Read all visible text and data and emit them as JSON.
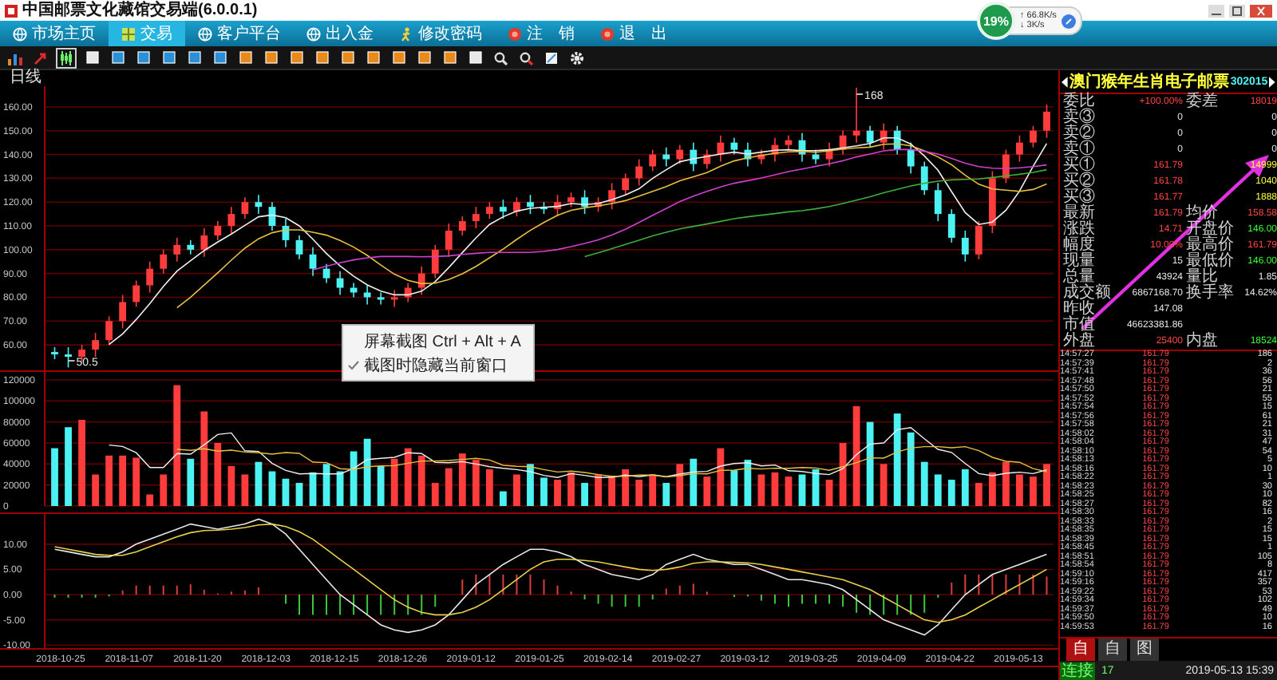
{
  "window": {
    "title": "中国邮票文化藏馆交易端(6.0.0.1)"
  },
  "network": {
    "percent": "19%",
    "upload": "↑ 66.8K/s",
    "download": "↓ 3K/s"
  },
  "tabs": [
    {
      "label": "市场主页",
      "selected": false
    },
    {
      "label": "交易",
      "selected": true
    },
    {
      "label": "客户平台",
      "selected": false
    },
    {
      "label": "出入金",
      "selected": false
    },
    {
      "label": "修改密码",
      "selected": false
    },
    {
      "label": "注　销",
      "selected": false
    },
    {
      "label": "退　出",
      "selected": false
    }
  ],
  "toolbar": [
    {
      "selected": false
    },
    {
      "selected": false
    },
    {
      "selected": true
    },
    {
      "selected": false
    },
    {
      "selected": false
    },
    {
      "selected": false
    },
    {
      "selected": false
    },
    {
      "selected": false
    },
    {
      "selected": false
    },
    {
      "selected": false
    },
    {
      "selected": false
    },
    {
      "selected": false
    },
    {
      "selected": false
    },
    {
      "selected": false
    },
    {
      "selected": false
    },
    {
      "selected": false
    },
    {
      "selected": false
    },
    {
      "selected": false
    },
    {
      "selected": false
    },
    {
      "selected": false
    },
    {
      "selected": false
    },
    {
      "selected": false
    },
    {
      "selected": false
    }
  ],
  "period": "日线",
  "price_chart": {
    "chart_data": {
      "type": "candlestick",
      "ylim": [
        49.3,
        168.7
      ],
      "grid": true,
      "series": [
        {
          "colors": [
            "#4cf2f2",
            "#4cf2f2",
            "#ff3c3c",
            "#ff3c3c",
            "#ff3c3c",
            "#ff3c3c",
            "#ff3c3c",
            "#ff3c3c",
            "#ff3c3c",
            "#ff3c3c",
            "#4cf2f2",
            "#ff3c3c",
            "#ff3c3c",
            "#ff3c3c",
            "#ff3c3c",
            "#4cf2f2",
            "#4cf2f2",
            "#4cf2f2",
            "#4cf2f2",
            "#4cf2f2",
            "#4cf2f2",
            "#4cf2f2",
            "#4cf2f2",
            "#4cf2f2",
            "#4cf2f2",
            "#ff3c3c",
            "#ff3c3c",
            "#ff3c3c",
            "#ff3c3c",
            "#ff3c3c",
            "#ff3c3c",
            "#ff3c3c",
            "#ff3c3c",
            "#4cf2f2",
            "#ff3c3c",
            "#4cf2f2",
            "#4cf2f2",
            "#ff3c3c",
            "#ff3c3c",
            "#4cf2f2",
            "#ff3c3c",
            "#ff3c3c",
            "#ff3c3c",
            "#ff3c3c",
            "#ff3c3c",
            "#4cf2f2",
            "#ff3c3c",
            "#4cf2f2",
            "#ff3c3c",
            "#ff3c3c",
            "#4cf2f2",
            "#4cf2f2",
            "#ff3c3c",
            "#ff3c3c",
            "#ff3c3c",
            "#4cf2f2",
            "#4cf2f2",
            "#ff3c3c",
            "#ff3c3c",
            "#ff3c3c",
            "#4cf2f2",
            "#ff3c3c",
            "#4cf2f2",
            "#4cf2f2",
            "#4cf2f2",
            "#4cf2f2",
            "#4cf2f2",
            "#4cf2f2",
            "#ff3c3c",
            "#ff3c3c",
            "#ff3c3c",
            "#ff3c3c",
            "#ff3c3c",
            "#ff3c3c"
          ],
          "ohlc": [
            [
              57,
              59,
              54,
              56
            ],
            [
              56,
              59,
              50.5,
              55
            ],
            [
              55,
              60,
              53,
              58
            ],
            [
              58,
              65,
              55,
              62
            ],
            [
              62,
              72,
              60,
              70
            ],
            [
              70,
              81,
              67,
              78
            ],
            [
              78,
              87,
              76,
              85
            ],
            [
              85,
              95,
              82,
              92
            ],
            [
              92,
              100,
              90,
              98
            ],
            [
              98,
              105,
              95,
              102
            ],
            [
              102,
              104,
              98,
              100
            ],
            [
              100,
              109,
              97,
              106
            ],
            [
              106,
              112,
              104,
              110
            ],
            [
              110,
              118,
              107,
              115
            ],
            [
              115,
              122,
              113,
              120
            ],
            [
              120,
              123,
              115,
              118
            ],
            [
              118,
              120,
              108,
              110
            ],
            [
              110,
              113,
              101,
              104
            ],
            [
              104,
              106,
              96,
              98
            ],
            [
              98,
              101,
              89,
              92
            ],
            [
              92,
              94,
              86,
              88
            ],
            [
              88,
              91,
              81,
              84
            ],
            [
              84,
              86,
              80,
              82
            ],
            [
              82,
              85,
              77,
              80
            ],
            [
              80,
              82,
              77,
              79
            ],
            [
              79,
              83,
              76,
              80
            ],
            [
              80,
              86,
              78,
              84
            ],
            [
              84,
              93,
              81,
              90
            ],
            [
              90,
              102,
              88,
              100
            ],
            [
              100,
              111,
              97,
              108
            ],
            [
              108,
              114,
              106,
              112
            ],
            [
              112,
              118,
              109,
              115
            ],
            [
              115,
              120,
              113,
              118
            ],
            [
              118,
              121,
              113,
              116
            ],
            [
              116,
              122,
              114,
              120
            ],
            [
              120,
              123,
              115,
              118
            ],
            [
              118,
              120,
              115,
              117
            ],
            [
              117,
              123,
              114,
              120
            ],
            [
              120,
              124,
              118,
              122
            ],
            [
              122,
              125,
              115,
              118
            ],
            [
              118,
              122,
              116,
              120
            ],
            [
              120,
              128,
              117,
              125
            ],
            [
              125,
              132,
              123,
              130
            ],
            [
              130,
              138,
              127,
              135
            ],
            [
              135,
              142,
              133,
              140
            ],
            [
              140,
              143,
              135,
              138
            ],
            [
              138,
              144,
              136,
              142
            ],
            [
              142,
              145,
              133,
              136
            ],
            [
              136,
              142,
              134,
              140
            ],
            [
              140,
              148,
              137,
              145
            ],
            [
              145,
              147,
              140,
              142
            ],
            [
              142,
              145,
              135,
              138
            ],
            [
              138,
              142,
              136,
              140
            ],
            [
              140,
              147,
              137,
              144
            ],
            [
              144,
              148,
              142,
              146
            ],
            [
              146,
              149,
              137,
              140
            ],
            [
              140,
              142,
              136,
              138
            ],
            [
              138,
              145,
              135,
              142
            ],
            [
              142,
              150,
              140,
              148
            ],
            [
              148,
              168,
              145,
              150
            ],
            [
              150,
              152,
              143,
              145
            ],
            [
              145,
              153,
              142,
              150
            ],
            [
              150,
              152,
              140,
              142
            ],
            [
              142,
              145,
              132,
              135
            ],
            [
              135,
              137,
              123,
              125
            ],
            [
              125,
              128,
              112,
              115
            ],
            [
              115,
              117,
              103,
              105
            ],
            [
              105,
              108,
              95,
              98
            ],
            [
              98,
              112,
              96,
              110
            ],
            [
              110,
              133,
              107,
              130
            ],
            [
              130,
              142,
              128,
              140
            ],
            [
              140,
              148,
              137,
              145
            ],
            [
              145,
              152,
              143,
              150
            ],
            [
              150,
              161,
              147,
              158
            ]
          ]
        },
        {
          "type": "line",
          "color": "#f0f0f0",
          "values": [
            null,
            null,
            null,
            null,
            60.2,
            64.6,
            70.6,
            77.4,
            84.6,
            91,
            95.4,
            99.6,
            103.2,
            106.6,
            110.2,
            113.8,
            114.6,
            113.4,
            110,
            104.4,
            98.4,
            93.2,
            88.8,
            85.2,
            82.6,
            81,
            81,
            82.6,
            86.6,
            92.4,
            98.8,
            105,
            110.6,
            113.8,
            116.2,
            117.4,
            117.8,
            118.2,
            119.4,
            119,
            119.4,
            121,
            123,
            125.6,
            130,
            133.6,
            137,
            138.2,
            139.2,
            140.2,
            141,
            140.2,
            141,
            141.8,
            142,
            141.6,
            141.6,
            142,
            142.8,
            143.6,
            144.6,
            147,
            147,
            144.4,
            139.4,
            133.4,
            124.4,
            115.6,
            110.6,
            111.6,
            116.6,
            124.6,
            135,
            144.6
          ]
        },
        {
          "type": "line",
          "color": "#e8c040",
          "values": [
            null,
            null,
            null,
            null,
            null,
            null,
            null,
            null,
            null,
            75.6,
            80,
            85.1,
            90.3,
            95.6,
            100.6,
            104.6,
            107.1,
            108.3,
            108.3,
            107.3,
            106.1,
            103.9,
            101.1,
            97.6,
            93.5,
            89.7,
            87.1,
            85.7,
            85.9,
            87.5,
            89.9,
            93,
            96.6,
            100.2,
            104.3,
            108.1,
            111.4,
            114.4,
            116.6,
            117.6,
            118.4,
            119.4,
            120.6,
            122.5,
            124.5,
            126.5,
            129,
            130.6,
            132.4,
            135.1,
            137.3,
            138.6,
            139.6,
            140.5,
            141.1,
            141.3,
            140.9,
            141.5,
            142.3,
            142.8,
            143.1,
            144.3,
            144.5,
            143.6,
            141.5,
            139,
            135.7,
            131.3,
            127.5,
            125.5,
            125,
            124.5,
            125.3,
            127.6
          ]
        },
        {
          "type": "line",
          "color": "#d040d0",
          "values": [
            null,
            null,
            null,
            null,
            null,
            null,
            null,
            null,
            null,
            null,
            null,
            null,
            null,
            null,
            null,
            null,
            null,
            null,
            null,
            91.5,
            93.1,
            94.5,
            95.7,
            96.6,
            97.1,
            97.2,
            97.1,
            97,
            97.1,
            97.4,
            98,
            98.5,
            98.9,
            98.9,
            98.9,
            98.9,
            99.3,
            100.1,
            101.3,
            102.6,
            104.2,
            106.2,
            108.6,
            111.4,
            114.4,
            117.3,
            120.2,
            122.5,
            124.5,
            126.4,
            127.9,
            129,
            130.1,
            131.5,
            132.8,
            133.9,
            135,
            136.1,
            137.4,
            139,
            140.2,
            141.5,
            142.1,
            142.1,
            141.3,
            140.2,
            138.3,
            136.4,
            134.9,
            134.2,
            134.1,
            134.4,
            134.9,
            135.6
          ]
        },
        {
          "type": "line",
          "color": "#3cb03c",
          "values": [
            null,
            null,
            null,
            null,
            null,
            null,
            null,
            null,
            null,
            null,
            null,
            null,
            null,
            null,
            null,
            null,
            null,
            null,
            null,
            null,
            null,
            null,
            null,
            null,
            null,
            null,
            null,
            null,
            null,
            null,
            null,
            null,
            null,
            null,
            null,
            null,
            null,
            null,
            null,
            97.1,
            98.7,
            100.4,
            102.2,
            104,
            105.8,
            107.3,
            108.7,
            109.8,
            110.8,
            111.9,
            113,
            113.8,
            114.5,
            115.2,
            115.9,
            116.4,
            117.2,
            118.1,
            119.4,
            120.8,
            122.2,
            123.9,
            125.4,
            126.8,
            127.9,
            128.8,
            129.3,
            129.5,
            129.7,
            130.3,
            131,
            131.7,
            132.5,
            133.6
          ]
        }
      ],
      "yticks": [
        {
          "value": 160,
          "label": "160.00"
        },
        {
          "value": 150,
          "label": "150.00"
        },
        {
          "value": 140,
          "label": "140.00"
        },
        {
          "value": 130,
          "label": "130.00"
        },
        {
          "value": 120,
          "label": "120.00"
        },
        {
          "value": 110,
          "label": "110.00"
        },
        {
          "value": 100,
          "label": "100.00"
        },
        {
          "value": 90,
          "label": "90.00"
        },
        {
          "value": 80,
          "label": "80.00"
        },
        {
          "value": 70,
          "label": "70.00"
        },
        {
          "value": 60,
          "label": "60.00"
        }
      ],
      "annotations": [
        "168",
        "50.5"
      ]
    }
  },
  "volume_chart": {
    "chart_data": {
      "type": "bar",
      "ylim": [
        0,
        127600
      ],
      "grid": true,
      "series": [
        {
          "type": "bar",
          "colors": [
            "#4cf2f2",
            "#4cf2f2",
            "#ff3c3c",
            "#ff3c3c",
            "#ff3c3c",
            "#ff3c3c",
            "#ff3c3c",
            "#ff3c3c",
            "#ff3c3c",
            "#ff3c3c",
            "#4cf2f2",
            "#ff3c3c",
            "#ff3c3c",
            "#ff3c3c",
            "#ff3c3c",
            "#4cf2f2",
            "#4cf2f2",
            "#4cf2f2",
            "#4cf2f2",
            "#4cf2f2",
            "#4cf2f2",
            "#4cf2f2",
            "#4cf2f2",
            "#4cf2f2",
            "#4cf2f2",
            "#ff3c3c",
            "#ff3c3c",
            "#ff3c3c",
            "#ff3c3c",
            "#ff3c3c",
            "#ff3c3c",
            "#ff3c3c",
            "#ff3c3c",
            "#4cf2f2",
            "#ff3c3c",
            "#4cf2f2",
            "#4cf2f2",
            "#ff3c3c",
            "#ff3c3c",
            "#4cf2f2",
            "#ff3c3c",
            "#ff3c3c",
            "#ff3c3c",
            "#ff3c3c",
            "#ff3c3c",
            "#4cf2f2",
            "#ff3c3c",
            "#4cf2f2",
            "#ff3c3c",
            "#ff3c3c",
            "#4cf2f2",
            "#4cf2f2",
            "#ff3c3c",
            "#ff3c3c",
            "#ff3c3c",
            "#4cf2f2",
            "#4cf2f2",
            "#ff3c3c",
            "#ff3c3c",
            "#ff3c3c",
            "#4cf2f2",
            "#ff3c3c",
            "#4cf2f2",
            "#4cf2f2",
            "#4cf2f2",
            "#4cf2f2",
            "#4cf2f2",
            "#4cf2f2",
            "#ff3c3c",
            "#ff3c3c",
            "#ff3c3c",
            "#ff3c3c",
            "#ff3c3c",
            "#ff3c3c"
          ],
          "values": [
            55000,
            75000,
            82000,
            30000,
            48000,
            48000,
            46000,
            11000,
            30000,
            115000,
            45000,
            90000,
            60000,
            38000,
            30000,
            42000,
            33000,
            26000,
            22000,
            32000,
            40000,
            33000,
            52000,
            64000,
            38000,
            45000,
            55000,
            48000,
            22000,
            36000,
            50000,
            44000,
            35000,
            14000,
            30000,
            40000,
            27000,
            25000,
            32000,
            22000,
            30000,
            28000,
            35000,
            25000,
            30000,
            22000,
            40000,
            45000,
            28000,
            55000,
            34000,
            44000,
            30000,
            32000,
            28000,
            30000,
            35000,
            25000,
            60000,
            95000,
            80000,
            40000,
            88000,
            70000,
            42000,
            30000,
            25000,
            35000,
            22000,
            32000,
            42000,
            30000,
            28000,
            40000
          ]
        },
        {
          "type": "line",
          "color": "#f0f0f0",
          "values": [
            null,
            null,
            null,
            null,
            58000,
            56600,
            50800,
            36600,
            36600,
            50000,
            49400,
            58200,
            68000,
            69600,
            52600,
            52000,
            40600,
            33800,
            30600,
            31000,
            30600,
            30600,
            35800,
            44200,
            45400,
            46400,
            50800,
            50000,
            41600,
            41200,
            42200,
            40000,
            37400,
            35800,
            34600,
            32600,
            29200,
            27200,
            30800,
            29200,
            27200,
            27400,
            29400,
            28000,
            29600,
            28000,
            30400,
            32400,
            33000,
            38000,
            40400,
            41200,
            38200,
            39000,
            33600,
            32800,
            31000,
            30000,
            35600,
            49000,
            59000,
            60000,
            72600,
            74600,
            64000,
            54000,
            51000,
            40400,
            30800,
            28800,
            31200,
            32200,
            30800,
            34400
          ]
        },
        {
          "type": "line",
          "color": "#e8c040",
          "values": [
            null,
            null,
            null,
            null,
            null,
            null,
            null,
            null,
            null,
            54000,
            53000,
            54500,
            52300,
            53100,
            51300,
            50700,
            49400,
            50900,
            50100,
            41800,
            41300,
            35600,
            34800,
            37400,
            38200,
            38500,
            40700,
            42900,
            42900,
            43300,
            44300,
            45400,
            43700,
            38700,
            37900,
            37400,
            34600,
            32300,
            33300,
            31900,
            29900,
            28300,
            28300,
            29400,
            29400,
            27600,
            28900,
            30900,
            30500,
            33800,
            34200,
            35800,
            35300,
            36000,
            35800,
            36600,
            36100,
            34100,
            37300,
            41300,
            45900,
            45500,
            51300,
            55100,
            56500,
            56500,
            55500,
            56500,
            52700,
            46400,
            42600,
            41600,
            35600,
            32600
          ]
        }
      ],
      "yticks": [
        {
          "value": 120000,
          "label": "120000"
        },
        {
          "value": 100000,
          "label": "100000"
        },
        {
          "value": 80000,
          "label": "80000"
        },
        {
          "value": 60000,
          "label": "60000"
        },
        {
          "value": 40000,
          "label": "40000"
        },
        {
          "value": 20000,
          "label": "20000"
        },
        {
          "value": 0,
          "label": "0"
        }
      ]
    }
  },
  "macd_chart": {
    "chart_data": {
      "type": "line",
      "ylim": [
        -10.6,
        16
      ],
      "grid": true,
      "series": [
        {
          "color": "#e8e8e8",
          "values": [
            9,
            8.5,
            8,
            7.5,
            7.5,
            8.5,
            10,
            11,
            12,
            13,
            14,
            13.5,
            13,
            13.5,
            14,
            15,
            14,
            12,
            9,
            6,
            3,
            0,
            -2,
            -4,
            -6,
            -7,
            -7.5,
            -7,
            -6,
            -4,
            -1,
            2,
            4,
            6,
            7.5,
            9,
            9,
            8.5,
            7.5,
            6,
            5,
            4,
            3.5,
            3,
            4,
            6,
            7,
            8,
            7,
            6.5,
            6,
            6,
            5,
            4,
            3,
            3,
            2.5,
            2,
            1,
            -1,
            -3,
            -5,
            -6,
            -7,
            -8,
            -6,
            -3,
            0,
            2,
            4,
            5,
            6,
            7,
            8
          ]
        },
        {
          "color": "#e6d24a",
          "values": [
            9.5,
            9,
            8.5,
            8,
            7.8,
            7.8,
            8.5,
            9.5,
            10.5,
            11.5,
            12.3,
            12.7,
            12.8,
            13,
            13.3,
            13.8,
            14,
            13.5,
            12.5,
            11,
            9,
            7,
            5,
            3,
            1,
            -1,
            -2.5,
            -3.5,
            -4,
            -4,
            -3.5,
            -2.5,
            -1,
            1,
            3,
            5,
            6.5,
            7,
            7,
            6.8,
            6.5,
            6,
            5.5,
            5,
            4.8,
            5,
            5.5,
            6.2,
            6.5,
            6.5,
            6.4,
            6.3,
            6,
            5.5,
            5,
            4.5,
            4,
            3.5,
            3,
            2,
            1,
            -0.5,
            -2,
            -3.5,
            -5,
            -5.5,
            -5,
            -4,
            -2.5,
            -1,
            0.5,
            2,
            3.5,
            5
          ]
        }
      ],
      "yticks": [
        {
          "value": 10,
          "label": "10.00"
        },
        {
          "value": 5,
          "label": "5.00"
        },
        {
          "value": 0,
          "label": "0.00"
        },
        {
          "value": -5,
          "label": "-5.00"
        },
        {
          "value": -10,
          "label": "-10.00"
        }
      ]
    }
  },
  "dates": [
    "2018-10-25",
    "2018-11-07",
    "2018-11-20",
    "2018-12-03",
    "2018-12-15",
    "2018-12-26",
    "2019-01-12",
    "2019-01-25",
    "2019-02-14",
    "2019-02-27",
    "2019-03-12",
    "2019-03-25",
    "2019-04-09",
    "2019-04-22",
    "2019-05-13"
  ],
  "context_menu": [
    {
      "label": "屏幕截图 Ctrl + Alt + A",
      "checked": false
    },
    {
      "label": "截图时隐藏当前窗口",
      "checked": true
    }
  ],
  "quote": {
    "name": "澳门猴年生肖电子邮票",
    "code": "302015",
    "rows": [
      {
        "label": "委比",
        "value": {
          "text": "+100.00%",
          "rise": true,
          "fall": false,
          "bid": false
        },
        "label2": "委差",
        "value2": {
          "text": "18019",
          "rise": true,
          "fall": false,
          "bid": false
        }
      },
      {
        "label": "卖③",
        "value": {
          "text": "0",
          "rise": false,
          "fall": false,
          "bid": false
        },
        "value2": {
          "text": "0",
          "rise": false,
          "fall": false,
          "bid": false
        }
      },
      {
        "label": "卖②",
        "value": {
          "text": "0",
          "rise": false,
          "fall": false,
          "bid": false
        },
        "value2": {
          "text": "0",
          "rise": false,
          "fall": false,
          "bid": false
        }
      },
      {
        "label": "卖①",
        "value": {
          "text": "0",
          "rise": false,
          "fall": false,
          "bid": false
        },
        "value2": {
          "text": "0",
          "rise": false,
          "fall": false,
          "bid": false
        }
      },
      {
        "label": "买①",
        "value": {
          "text": "161.79",
          "rise": true,
          "fall": false,
          "bid": false
        },
        "value2": {
          "text": "14999",
          "rise": false,
          "fall": false,
          "bid": true
        }
      },
      {
        "label": "买②",
        "value": {
          "text": "161.78",
          "rise": true,
          "fall": false,
          "bid": false
        },
        "value2": {
          "text": "1040",
          "rise": false,
          "fall": false,
          "bid": true
        }
      },
      {
        "label": "买③",
        "value": {
          "text": "161.77",
          "rise": true,
          "fall": false,
          "bid": false
        },
        "value2": {
          "text": "1888",
          "rise": false,
          "fall": false,
          "bid": true
        }
      },
      {
        "label": "最新",
        "value": {
          "text": "161.79",
          "rise": true,
          "fall": false,
          "bid": false
        },
        "label2": "均价",
        "value2": {
          "text": "158.58",
          "rise": true,
          "fall": false,
          "bid": false
        }
      },
      {
        "label": "涨跌",
        "value": {
          "text": "14.71",
          "rise": true,
          "fall": false,
          "bid": false
        },
        "label2": "开盘价",
        "value2": {
          "text": "146.00",
          "rise": false,
          "fall": true,
          "bid": false
        }
      },
      {
        "label": "幅度",
        "value": {
          "text": "10.00%",
          "rise": true,
          "fall": false,
          "bid": false
        },
        "label2": "最高价",
        "value2": {
          "text": "161.79",
          "rise": true,
          "fall": false,
          "bid": false
        }
      },
      {
        "label": "现量",
        "value": {
          "text": "15",
          "rise": false,
          "fall": false,
          "bid": false
        },
        "label2": "最低价",
        "value2": {
          "text": "146.00",
          "rise": false,
          "fall": true,
          "bid": false
        }
      },
      {
        "label": "总量",
        "value": {
          "text": "43924",
          "rise": false,
          "fall": false,
          "bid": false
        },
        "label2": "量比",
        "value2": {
          "text": "1.85",
          "rise": false,
          "fall": false,
          "bid": false
        }
      },
      {
        "label": "成交额",
        "value": {
          "text": "6867168.70",
          "rise": false,
          "fall": false,
          "bid": false
        },
        "label2": "换手率",
        "value2": {
          "text": "14.62%",
          "rise": false,
          "fall": false,
          "bid": false
        }
      },
      {
        "label": "昨收",
        "value": {
          "text": "147.08",
          "rise": false,
          "fall": false,
          "bid": false
        }
      },
      {
        "label": "市值",
        "value": {
          "text": "46623381.86",
          "rise": false,
          "fall": false,
          "bid": false
        }
      },
      {
        "label": "外盘",
        "value": {
          "text": "25400",
          "rise": true,
          "fall": false,
          "bid": false
        },
        "label2": "内盘",
        "value2": {
          "text": "18524",
          "rise": false,
          "fall": true,
          "bid": false
        }
      }
    ]
  },
  "ticks": [
    {
      "time": "14:57:27",
      "price": "161.79",
      "volume": "186"
    },
    {
      "time": "14:57:39",
      "price": "161.79",
      "volume": "2"
    },
    {
      "time": "14:57:41",
      "price": "161.79",
      "volume": "36"
    },
    {
      "time": "14:57:48",
      "price": "161.79",
      "volume": "56"
    },
    {
      "time": "14:57:50",
      "price": "161.79",
      "volume": "21"
    },
    {
      "time": "14:57:52",
      "price": "161.79",
      "volume": "55"
    },
    {
      "time": "14:57:54",
      "price": "161.79",
      "volume": "15"
    },
    {
      "time": "14:57:56",
      "price": "161.79",
      "volume": "61"
    },
    {
      "time": "14:57:58",
      "price": "161.79",
      "volume": "21"
    },
    {
      "time": "14:58:02",
      "price": "161.79",
      "volume": "31"
    },
    {
      "time": "14:58:04",
      "price": "161.79",
      "volume": "47"
    },
    {
      "time": "14:58:10",
      "price": "161.79",
      "volume": "54"
    },
    {
      "time": "14:58:13",
      "price": "161.79",
      "volume": "5"
    },
    {
      "time": "14:58:16",
      "price": "161.79",
      "volume": "10"
    },
    {
      "time": "14:58:22",
      "price": "161.79",
      "volume": "1"
    },
    {
      "time": "14:58:23",
      "price": "161.79",
      "volume": "30"
    },
    {
      "time": "14:58:25",
      "price": "161.79",
      "volume": "10"
    },
    {
      "time": "14:58:27",
      "price": "161.79",
      "volume": "82"
    },
    {
      "time": "14:58:30",
      "price": "161.79",
      "volume": "16"
    },
    {
      "time": "14:58:33",
      "price": "161.79",
      "volume": "2"
    },
    {
      "time": "14:58:35",
      "price": "161.79",
      "volume": "15"
    },
    {
      "time": "14:58:39",
      "price": "161.79",
      "volume": "15"
    },
    {
      "time": "14:58:45",
      "price": "161.79",
      "volume": "1"
    },
    {
      "time": "14:58:51",
      "price": "161.79",
      "volume": "105"
    },
    {
      "time": "14:58:54",
      "price": "161.79",
      "volume": "8"
    },
    {
      "time": "14:59:10",
      "price": "161.79",
      "volume": "417"
    },
    {
      "time": "14:59:16",
      "price": "161.79",
      "volume": "357"
    },
    {
      "time": "14:59:22",
      "price": "161.79",
      "volume": "53"
    },
    {
      "time": "14:59:34",
      "price": "161.79",
      "volume": "102"
    },
    {
      "time": "14:59:37",
      "price": "161.79",
      "volume": "49"
    },
    {
      "time": "14:59:50",
      "price": "161.79",
      "volume": "10"
    },
    {
      "time": "14:59:53",
      "price": "161.79",
      "volume": "16"
    }
  ],
  "panel_tabs": [
    {
      "label": "自",
      "selected": true
    },
    {
      "label": "自",
      "selected": false
    },
    {
      "label": "图",
      "selected": false
    }
  ],
  "status": {
    "connection": "连接",
    "count": "17",
    "datetime": "2019-05-13 15:39"
  }
}
